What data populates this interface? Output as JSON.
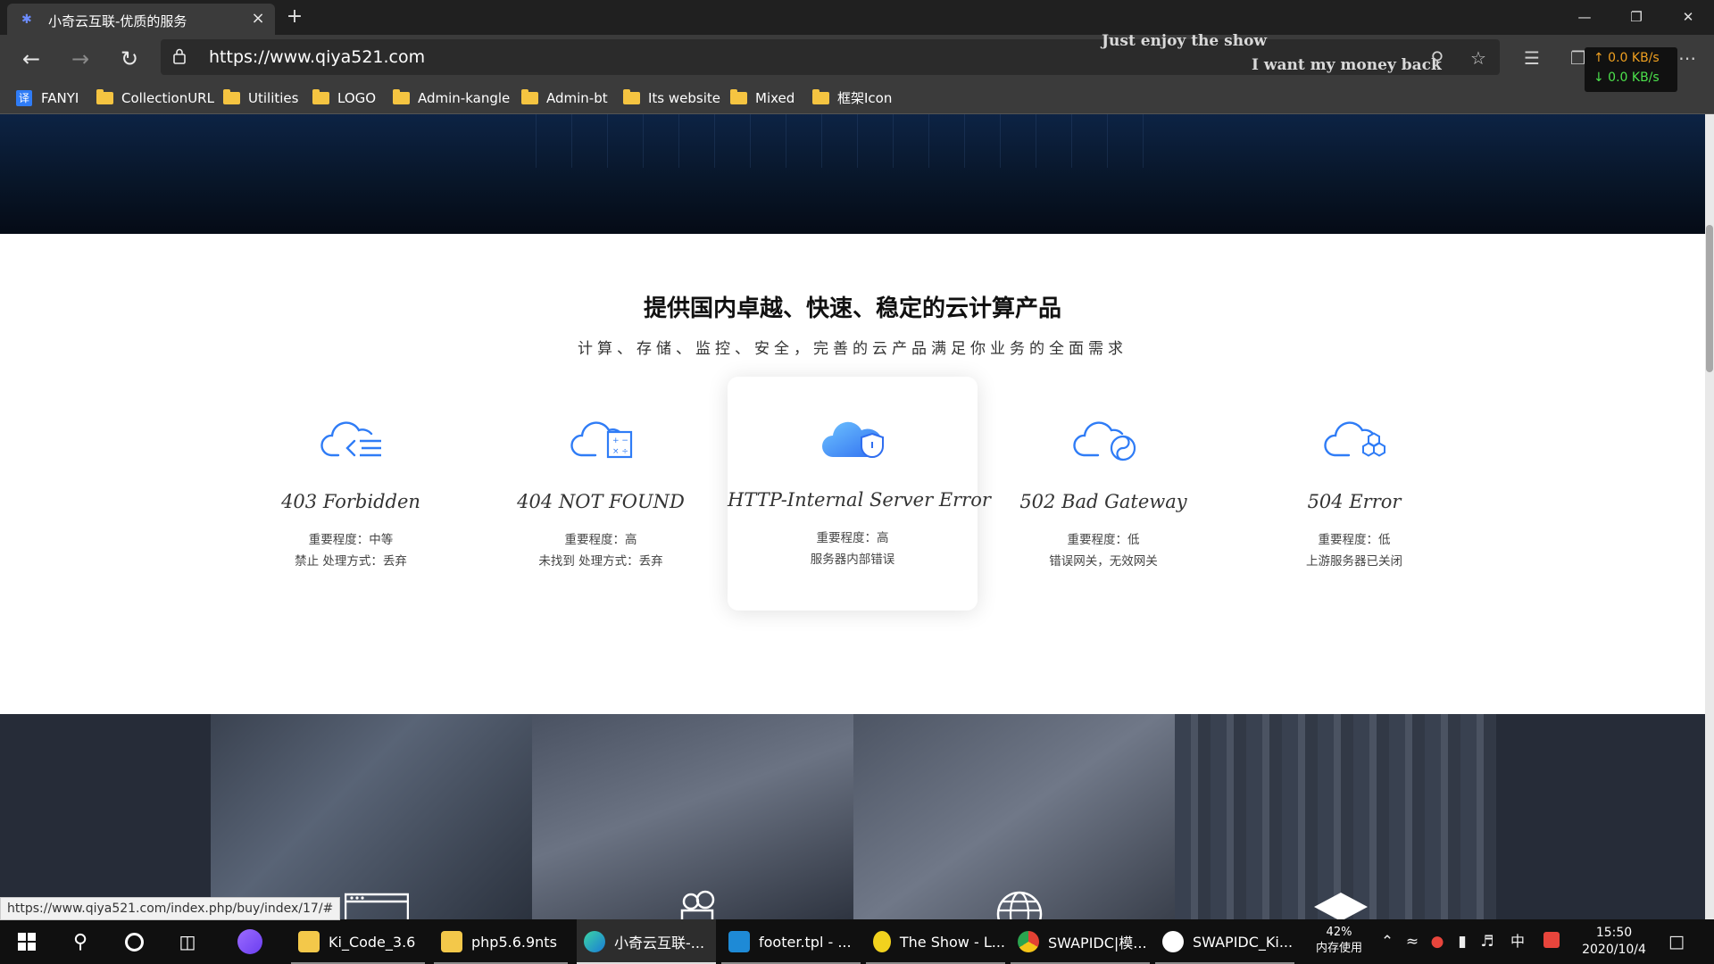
{
  "browser": {
    "tab_title": "小奇云互联-优质的服务",
    "new_tab_icon": "+",
    "url": "https://www.qiya521.com",
    "lyric_line1": "Just enjoy the show",
    "lyric_line2": "I want my money back",
    "speed_up": "↑ 0.0 KB/s",
    "speed_down": "↓ 0.0 KB/s"
  },
  "bookmarks": [
    {
      "label": "FANYI",
      "icon": "translate-icon"
    },
    {
      "label": "CollectionURL",
      "icon": "folder-icon"
    },
    {
      "label": "Utilities",
      "icon": "folder-icon"
    },
    {
      "label": "LOGO",
      "icon": "folder-icon"
    },
    {
      "label": "Admin-kangle",
      "icon": "folder-icon"
    },
    {
      "label": "Admin-bt",
      "icon": "folder-icon"
    },
    {
      "label": "Its website",
      "icon": "folder-icon"
    },
    {
      "label": "Mixed",
      "icon": "folder-icon"
    },
    {
      "label": "框架Icon",
      "icon": "folder-icon"
    }
  ],
  "section": {
    "heading": "提供国内卓越、快速、稳定的云计算产品",
    "subheading": "计算、存储、监控、安全，完善的云产品满足你业务的全面需求"
  },
  "cards": [
    {
      "title": "403 Forbidden",
      "line1": "重要程度：中等",
      "line2": "禁止 处理方式：丢弃"
    },
    {
      "title": "404 NOT FOUND",
      "line1": "重要程度：高",
      "line2": "未找到 处理方式：丢弃"
    },
    {
      "title": "HTTP-Internal Server Error",
      "line1": "重要程度：高",
      "line2": "服务器内部错误"
    },
    {
      "title": "502 Bad Gateway",
      "line1": "重要程度：低",
      "line2": "错误网关，无效网关"
    },
    {
      "title": "504 Error",
      "line1": "重要程度：低",
      "line2": "上游服务器已关闭"
    }
  ],
  "status_url": "https://www.qiya521.com/index.php/buy/index/17/#",
  "taskbar": {
    "apps": [
      {
        "label": "Ki_Code_3.6",
        "icon": "folder-icon"
      },
      {
        "label": "php5.6.9nts",
        "icon": "folder-icon"
      },
      {
        "label": "小奇云互联-...",
        "icon": "edge-icon"
      },
      {
        "label": "footer.tpl - ...",
        "icon": "vscode-icon"
      },
      {
        "label": "The Show - L...",
        "icon": "music-icon"
      },
      {
        "label": "SWAPIDC|模...",
        "icon": "chrome-icon"
      },
      {
        "label": "SWAPIDC_Ki...",
        "icon": "app-icon"
      }
    ],
    "memory_percent": "42%",
    "memory_label": "内存使用",
    "ime": "中",
    "time": "15:50",
    "date": "2020/10/4"
  },
  "colors": {
    "accent_blue": "#2f7cf6",
    "hero_dark": "#081629",
    "taskbar": "#101010"
  }
}
